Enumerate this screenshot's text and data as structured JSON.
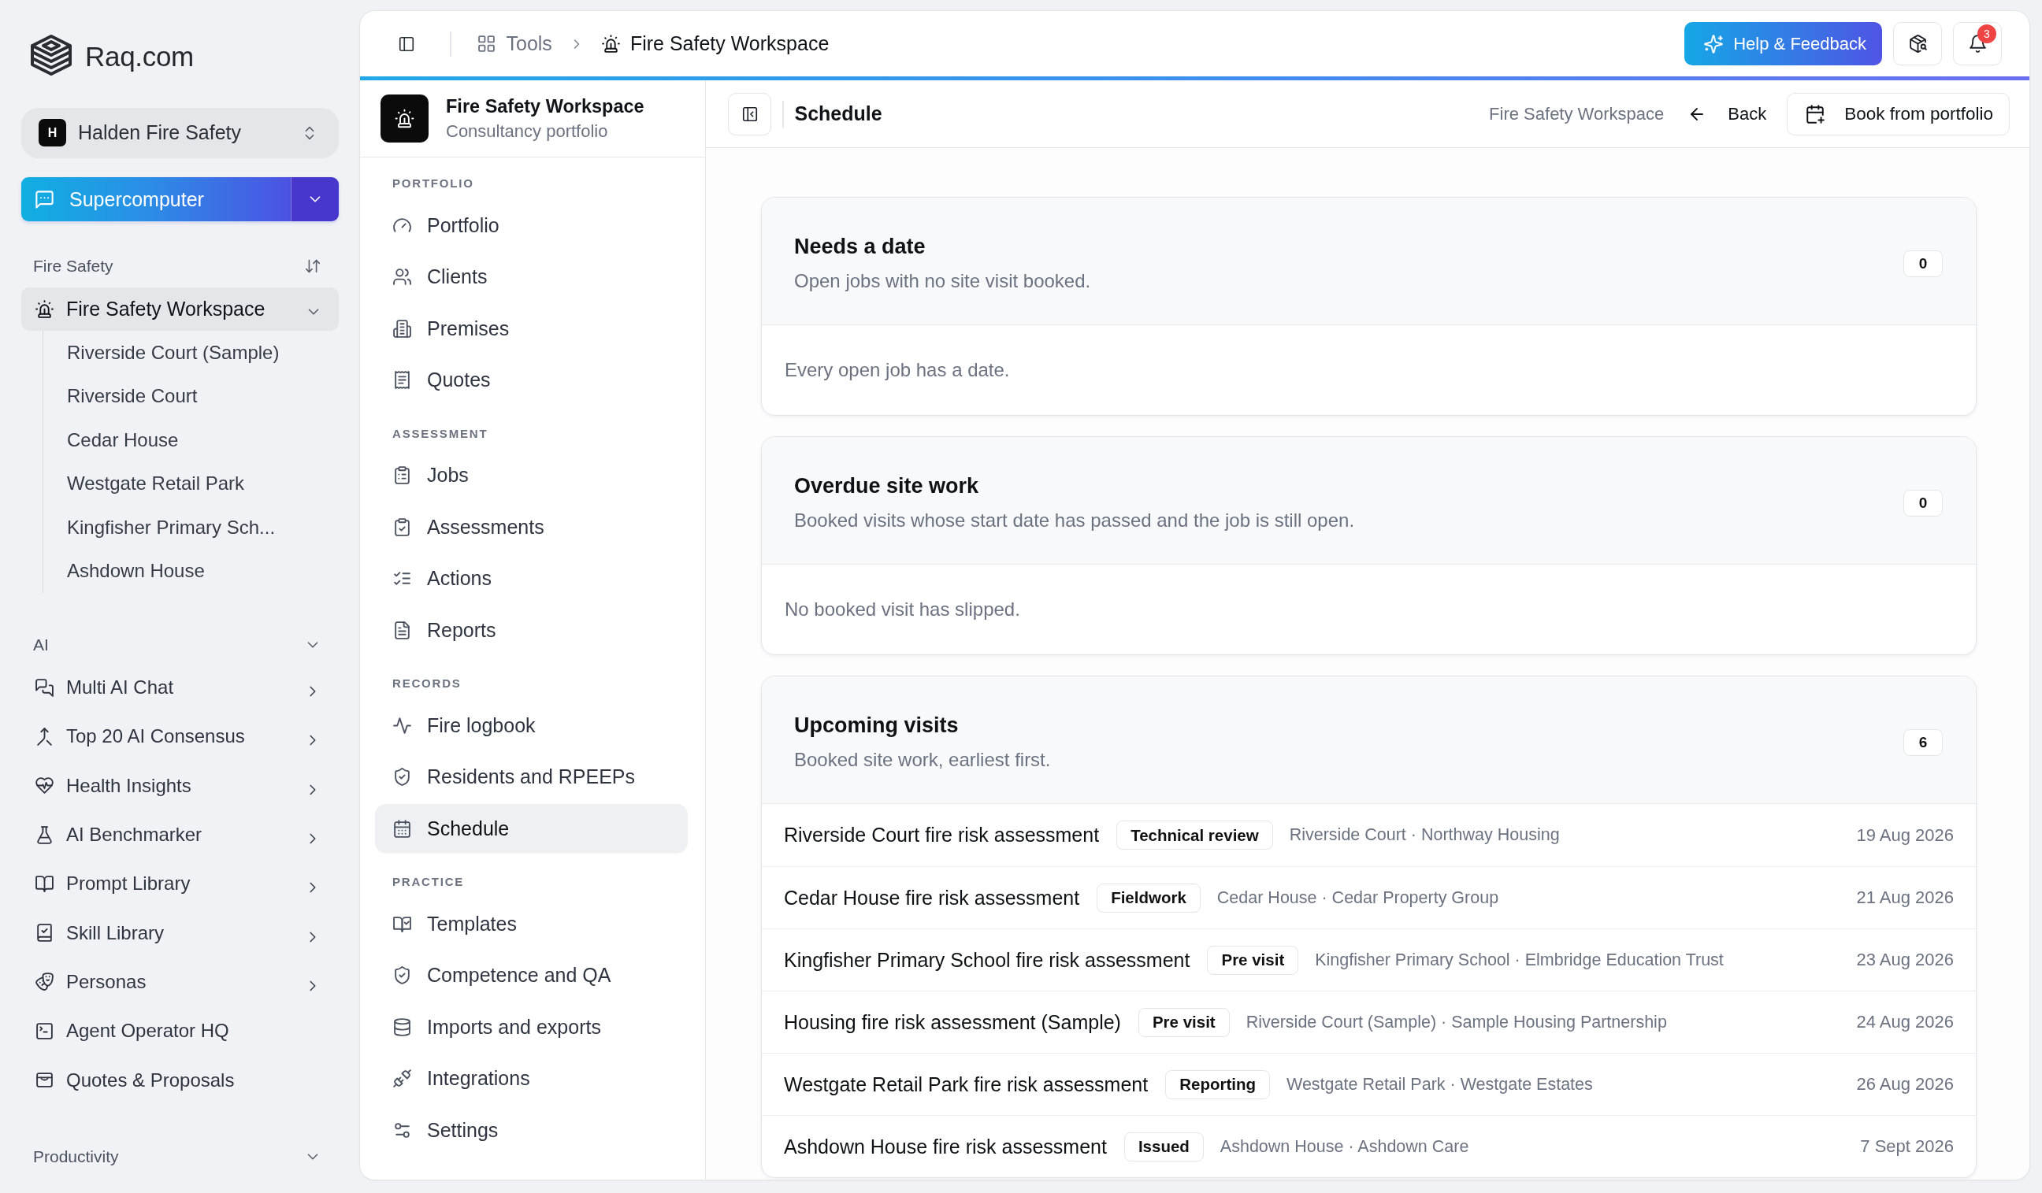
{
  "sidebar": {
    "brand": "Raq.com",
    "organization": {
      "initial": "H",
      "name": "Halden Fire Safety"
    },
    "assistant_button": {
      "label": "Supercomputer"
    },
    "sections": [
      {
        "title": "Fire Safety",
        "kind": "workspaces",
        "items": [
          {
            "label": "Fire Safety Workspace",
            "selected": true,
            "expanded": true,
            "children": [
              {
                "label": "Riverside Court (Sample)",
                "selected": false
              },
              {
                "label": "Riverside Court",
                "selected": false
              },
              {
                "label": "Cedar House",
                "selected": false
              },
              {
                "label": "Westgate Retail Park",
                "selected": false
              },
              {
                "label": "Kingfisher Primary Sch...",
                "selected": false
              },
              {
                "label": "Ashdown House",
                "selected": false
              }
            ]
          }
        ]
      },
      {
        "title": "AI",
        "kind": "tools",
        "expanded": true,
        "items": [
          {
            "label": "Multi AI Chat",
            "selected": false,
            "has_submenu": true
          },
          {
            "label": "Top 20 AI Consensus",
            "selected": false,
            "has_submenu": true
          },
          {
            "label": "Health Insights",
            "selected": false,
            "has_submenu": true
          },
          {
            "label": "AI Benchmarker",
            "selected": false,
            "has_submenu": true
          },
          {
            "label": "Prompt Library",
            "selected": false,
            "has_submenu": true
          },
          {
            "label": "Skill Library",
            "selected": false,
            "has_submenu": true
          },
          {
            "label": "Personas",
            "selected": false,
            "has_submenu": true
          },
          {
            "label": "Agent Operator HQ",
            "selected": false,
            "has_submenu": false
          },
          {
            "label": "Quotes & Proposals",
            "selected": false,
            "has_submenu": false
          }
        ]
      },
      {
        "title": "Productivity",
        "kind": "tools",
        "expanded": true
      }
    ]
  },
  "topbar": {
    "breadcrumbs": [
      {
        "label": "Tools",
        "current": false
      },
      {
        "label": "Fire Safety Workspace",
        "current": true
      }
    ],
    "help_button": "Help & Feedback",
    "notification_count": "3"
  },
  "workspace_nav": {
    "title": "Fire Safety Workspace",
    "subtitle": "Consultancy portfolio",
    "groups": [
      {
        "heading": "PORTFOLIO",
        "items": [
          {
            "label": "Portfolio",
            "selected": false
          },
          {
            "label": "Clients",
            "selected": false
          },
          {
            "label": "Premises",
            "selected": false
          },
          {
            "label": "Quotes",
            "selected": false
          }
        ]
      },
      {
        "heading": "ASSESSMENT",
        "items": [
          {
            "label": "Jobs",
            "selected": false
          },
          {
            "label": "Assessments",
            "selected": false
          },
          {
            "label": "Actions",
            "selected": false
          },
          {
            "label": "Reports",
            "selected": false
          }
        ]
      },
      {
        "heading": "RECORDS",
        "items": [
          {
            "label": "Fire logbook",
            "selected": false
          },
          {
            "label": "Residents and RPEEPs",
            "selected": false
          },
          {
            "label": "Schedule",
            "selected": true
          }
        ]
      },
      {
        "heading": "PRACTICE",
        "items": [
          {
            "label": "Templates",
            "selected": false
          },
          {
            "label": "Competence and QA",
            "selected": false
          },
          {
            "label": "Imports and exports",
            "selected": false
          },
          {
            "label": "Integrations",
            "selected": false
          },
          {
            "label": "Settings",
            "selected": false
          }
        ]
      }
    ]
  },
  "page_header": {
    "title": "Schedule",
    "context": "Fire Safety Workspace",
    "back_link": "Back",
    "primary_button": "Book from portfolio"
  },
  "schedule_sections": [
    {
      "title": "Needs a date",
      "description": "Open jobs with no site visit booked.",
      "count": "0",
      "empty_message": "Every open job has a date."
    },
    {
      "title": "Overdue site work",
      "description": "Booked visits whose start date has passed and the job is still open.",
      "count": "0",
      "empty_message": "No booked visit has slipped."
    },
    {
      "title": "Upcoming visits",
      "description": "Booked site work, earliest first.",
      "count": "6",
      "visits": [
        {
          "title": "Riverside Court fire risk assessment",
          "status": "Technical review",
          "location": "Riverside Court · Northway Housing",
          "date": "19 Aug 2026"
        },
        {
          "title": "Cedar House fire risk assessment",
          "status": "Fieldwork",
          "location": "Cedar House · Cedar Property Group",
          "date": "21 Aug 2026"
        },
        {
          "title": "Kingfisher Primary School fire risk assessment",
          "status": "Pre visit",
          "location": "Kingfisher Primary School · Elmbridge Education Trust",
          "date": "23 Aug 2026"
        },
        {
          "title": "Housing fire risk assessment (Sample)",
          "status": "Pre visit",
          "location": "Riverside Court (Sample) · Sample Housing Partnership",
          "date": "24 Aug 2026"
        },
        {
          "title": "Westgate Retail Park fire risk assessment",
          "status": "Reporting",
          "location": "Westgate Retail Park · Westgate Estates",
          "date": "26 Aug 2026"
        },
        {
          "title": "Ashdown House fire risk assessment",
          "status": "Issued",
          "location": "Ashdown House · Ashdown Care",
          "date": "7 Sept 2026"
        }
      ]
    }
  ]
}
